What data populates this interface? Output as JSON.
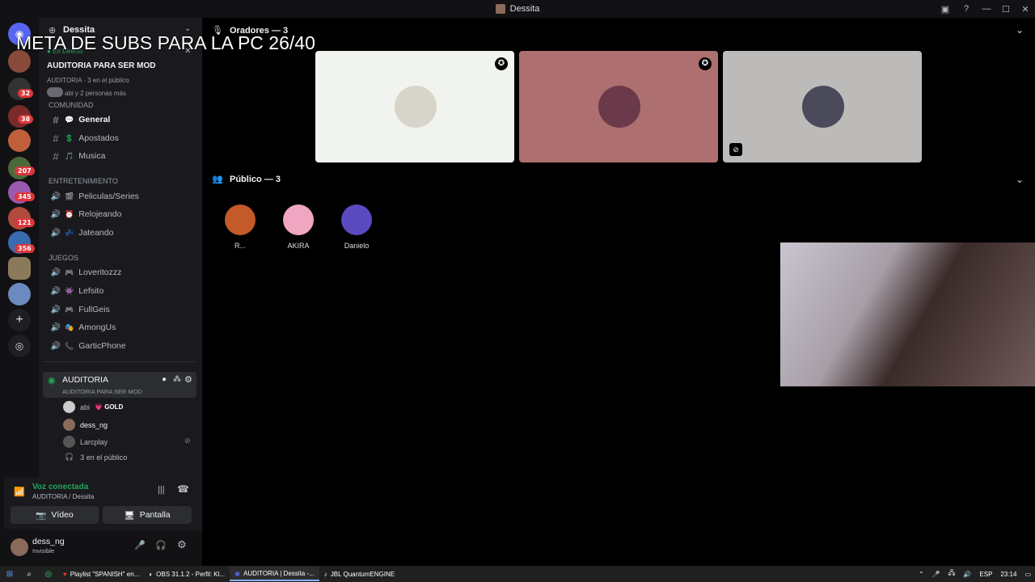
{
  "window": {
    "title": "Dessita"
  },
  "rail": {
    "badges": [
      "32",
      "38",
      "207",
      "345",
      "121",
      "356"
    ]
  },
  "server": {
    "name": "Dessita",
    "event_status": "En Directo",
    "event_title": "AUDITORIA PARA SER MOD",
    "event_meta": "AUDITORIA · 3 en el público",
    "event_people": "abi y 2 personas más"
  },
  "categories": {
    "comunidad": "COMUNIDAD",
    "entretenimiento": "ENTRETENIMIENTO",
    "juegos": "JUEGOS"
  },
  "channels": {
    "text": [
      {
        "label": "General",
        "emoji": "💬"
      },
      {
        "label": "Apostados",
        "emoji": "💲"
      },
      {
        "label": "Musica",
        "emoji": "🎵"
      }
    ],
    "entretenimiento": [
      {
        "label": "Peliculas/Series",
        "emoji": "🎬"
      },
      {
        "label": "Relojeando",
        "emoji": "⏰"
      },
      {
        "label": "Jateando",
        "emoji": "💤"
      }
    ],
    "juegos": [
      {
        "label": "Loveritozzz",
        "emoji": "🎮"
      },
      {
        "label": "Lefsito",
        "emoji": "👾"
      },
      {
        "label": "FullGeis",
        "emoji": "🎮"
      },
      {
        "label": "AmongUs",
        "emoji": "🎭"
      },
      {
        "label": "GarticPhone",
        "emoji": "📞"
      }
    ]
  },
  "stage_channel": {
    "name": "AUDITORIA",
    "topic": "AUDITORIA PARA SER MOD",
    "users": [
      {
        "name": "abi",
        "tag": "GOLD"
      },
      {
        "name": "dess_ng"
      },
      {
        "name": "Larcplay"
      }
    ],
    "audience_note": "3 en el público"
  },
  "voice": {
    "status": "Voz conectada",
    "location": "AUDITORIA / Dessita",
    "video_label": "Vídeo",
    "screen_label": "Pantalla"
  },
  "user": {
    "name": "dess_ng",
    "status": "Invisible"
  },
  "stage": {
    "speakers_header": "Oradores — 3",
    "audience_header": "Público — 3",
    "speakers": [
      {
        "bg": "#f1f3ee"
      },
      {
        "bg": "#ad6f6f"
      },
      {
        "bg": "#bcbbba"
      }
    ],
    "audience": [
      {
        "name": "R..."
      },
      {
        "name": "AKIRA"
      },
      {
        "name": "Danielo"
      }
    ]
  },
  "overlay_text": "META DE SUBS PARA LA PC 26/40",
  "taskbar": {
    "tasks": [
      {
        "label": "Playlist \"SPANISH\" en..."
      },
      {
        "label": "OBS 31.1.2 - Perfil: Kl..."
      },
      {
        "label": "AUDITORIA | Dessita -..."
      },
      {
        "label": "JBL QuantumENGINE"
      }
    ],
    "lang": "ESP",
    "time": "23:14"
  },
  "colors": {
    "accent_green": "#23a55a",
    "discord_blurple": "#5865f2",
    "bg": "#000000"
  }
}
